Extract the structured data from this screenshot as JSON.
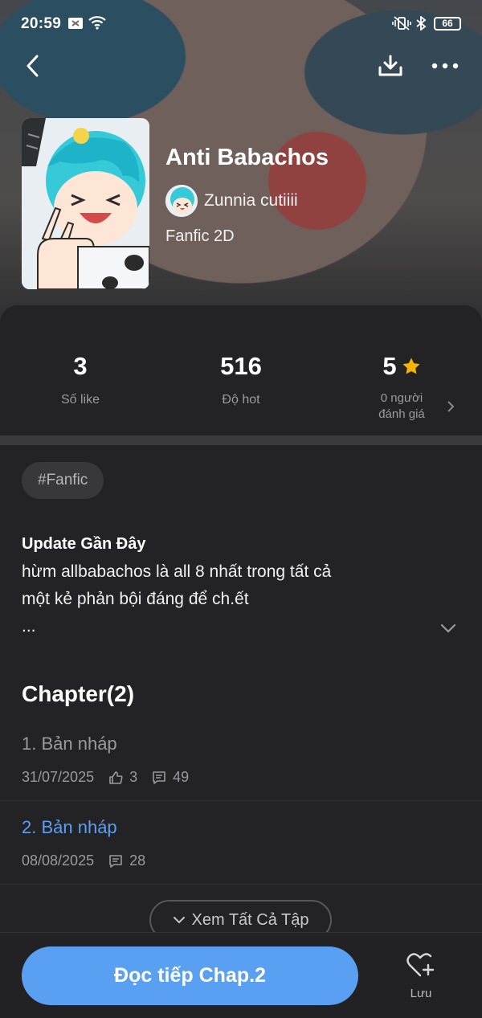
{
  "status_bar": {
    "time": "20:59",
    "battery": "66"
  },
  "header": {
    "title": "Anti Babachos",
    "author": "Zunnia cutiiii",
    "genre": "Fanfic 2D"
  },
  "stats": {
    "likes": {
      "value": "3",
      "label": "Số like"
    },
    "hot": {
      "value": "516",
      "label": "Độ hot"
    },
    "rating": {
      "value": "5",
      "label_line1": "0 người",
      "label_line2": "đánh giá"
    }
  },
  "tag": "#Fanfic",
  "update": {
    "title": "Update Gần Đây",
    "lines": [
      "hừm allbabachos là all 8 nhất trong tất cả",
      "một kẻ phản bội đáng để ch.ết",
      "..."
    ]
  },
  "chapters": {
    "title": "Chapter(2)",
    "items": [
      {
        "name": "1. Bản nháp",
        "date": "31/07/2025",
        "likes": "3",
        "comments": "49",
        "color": "#9a9a9e"
      },
      {
        "name": "2. Bản nháp",
        "date": "08/08/2025",
        "comments": "28",
        "color": "#5aa0f2"
      }
    ],
    "view_all": "Xem Tất Cả Tập"
  },
  "bottom": {
    "read_label": "Đọc tiếp Chap.2",
    "save_label": "Lưu"
  },
  "colors": {
    "accent": "#5aa0f2",
    "star": "#f5b400",
    "background": "#232325"
  }
}
